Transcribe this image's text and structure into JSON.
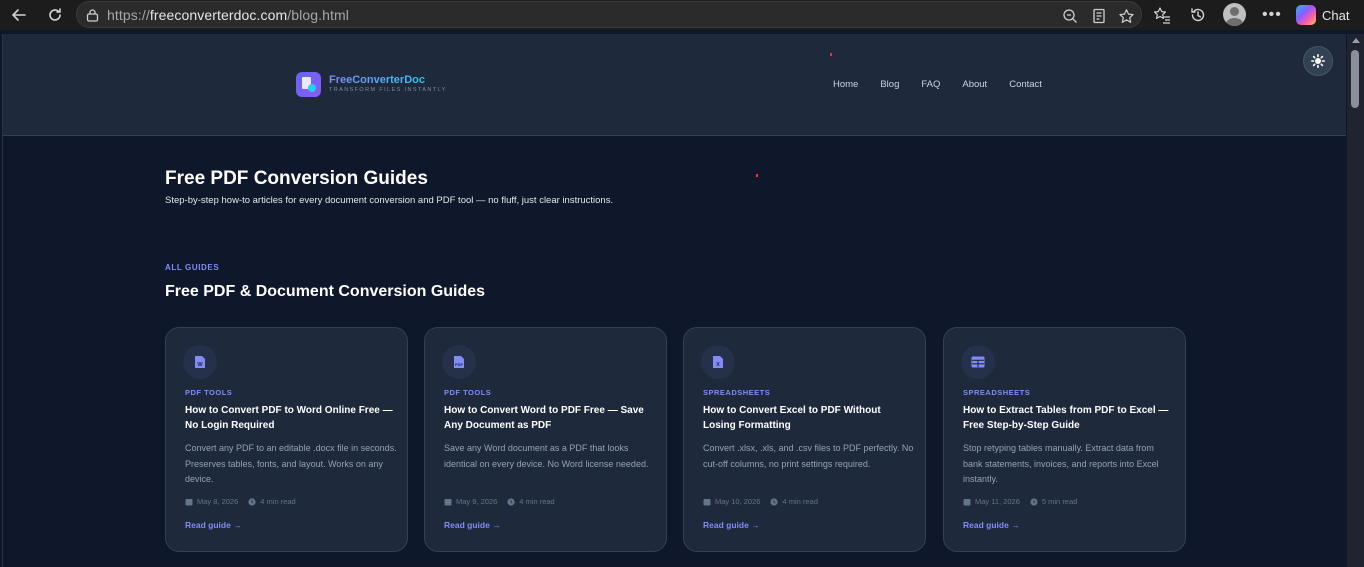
{
  "browser": {
    "url_scheme": "https://",
    "url_host": "freeconverterdoc.com",
    "url_path": "/blog.html",
    "chat_label": "Chat"
  },
  "site": {
    "brand_name": "FreeConverterDoc",
    "brand_tagline": "TRANSFORM FILES INSTANTLY",
    "nav": [
      "Home",
      "Blog",
      "FAQ",
      "About",
      "Contact"
    ]
  },
  "hero": {
    "title": "Free PDF Conversion Guides",
    "subtitle": "Step-by-step how-to articles for every document conversion and PDF tool — no fluff, just clear instructions."
  },
  "section": {
    "label": "ALL GUIDES",
    "title": "Free PDF & Document Conversion Guides"
  },
  "cards": [
    {
      "icon": "word-file-icon",
      "category": "PDF TOOLS",
      "title": "How to Convert PDF to Word Online Free — No Login Required",
      "desc": "Convert any PDF to an editable .docx file in seconds. Preserves tables, fonts, and layout. Works on any device.",
      "date": "May 8, 2026",
      "read": "4 min read",
      "link": "Read guide"
    },
    {
      "icon": "pdf-file-icon",
      "category": "PDF TOOLS",
      "title": "How to Convert Word to PDF Free — Save Any Document as PDF",
      "desc": "Save any Word document as a PDF that looks identical on every device. No Word license needed.",
      "date": "May 9, 2026",
      "read": "4 min read",
      "link": "Read guide"
    },
    {
      "icon": "excel-file-icon",
      "category": "SPREADSHEETS",
      "title": "How to Convert Excel to PDF Without Losing Formatting",
      "desc": "Convert .xlsx, .xls, and .csv files to PDF perfectly. No cut-off columns, no print settings required.",
      "date": "May 10, 2026",
      "read": "4 min read",
      "link": "Read guide"
    },
    {
      "icon": "table-icon",
      "category": "SPREADSHEETS",
      "title": "How to Extract Tables from PDF to Excel — Free Step-by-Step Guide",
      "desc": "Stop retyping tables manually. Extract data from bank statements, invoices, and reports into Excel instantly.",
      "date": "May 11, 2026",
      "read": "5 min read",
      "link": "Read guide"
    }
  ]
}
